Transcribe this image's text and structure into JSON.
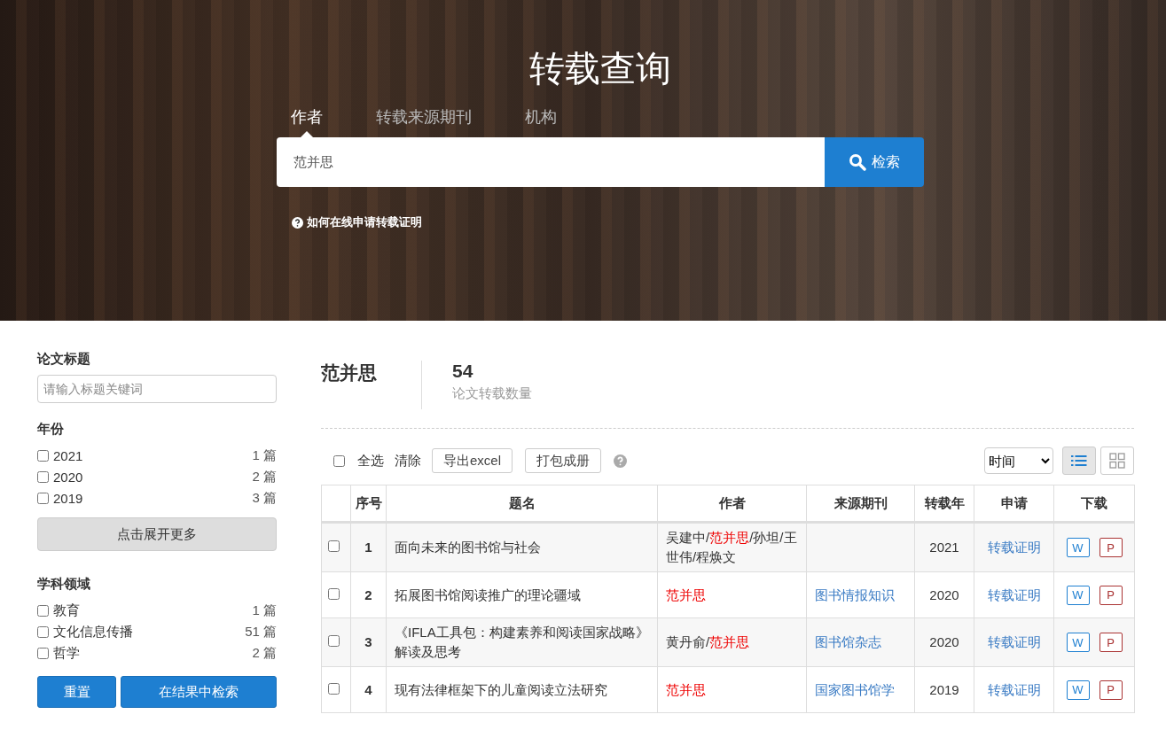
{
  "hero": {
    "title": "转载查询",
    "tabs": [
      {
        "label": "作者",
        "selected": true
      },
      {
        "label": "转载来源期刊",
        "selected": false
      },
      {
        "label": "机构",
        "selected": false
      }
    ],
    "search": {
      "value": "范并思",
      "button": "检索"
    },
    "help_link": "如何在线申请转载证明"
  },
  "sidebar": {
    "title_filter": {
      "heading": "论文标题",
      "placeholder": "请输入标题关键词"
    },
    "year_filter": {
      "heading": "年份",
      "items": [
        {
          "label": "2021",
          "count": "1 篇",
          "checked": false
        },
        {
          "label": "2020",
          "count": "2 篇",
          "checked": false
        },
        {
          "label": "2019",
          "count": "3 篇",
          "checked": false
        }
      ],
      "more_button": "点击展开更多"
    },
    "subject_filter": {
      "heading": "学科领域",
      "items": [
        {
          "label": "教育",
          "count": "1 篇",
          "checked": false
        },
        {
          "label": "文化信息传播",
          "count": "51 篇",
          "checked": false
        },
        {
          "label": "哲学",
          "count": "2 篇",
          "checked": false
        }
      ]
    },
    "buttons": [
      "重置",
      "在结果中检索"
    ]
  },
  "summary": {
    "author": "范并思",
    "count": "54",
    "count_label": "论文转载数量"
  },
  "toolbar": {
    "select_all": {
      "label": "全选",
      "checked": false
    },
    "clear": "清除",
    "export": "导出excel",
    "pack": "打包成册",
    "sort": "时间",
    "views": [
      {
        "kind": "list",
        "selected": true
      },
      {
        "kind": "grid",
        "selected": false
      }
    ]
  },
  "table": {
    "columns": [
      "序号",
      "题名",
      "作者",
      "来源期刊",
      "转载年",
      "申请",
      "下载"
    ],
    "rows": [
      {
        "checked": false,
        "index": "1",
        "title": "面向未来的图书馆与社会",
        "authors": [
          {
            "text": "吴建中/",
            "highlight": false
          },
          {
            "text": "范并思",
            "highlight": true
          },
          {
            "text": "/孙坦/王世伟/程焕文",
            "highlight": false
          }
        ],
        "journal": "",
        "year": "2021",
        "apply": "转载证明",
        "downloads": [
          "W",
          "P"
        ]
      },
      {
        "checked": false,
        "index": "2",
        "title": "拓展图书馆阅读推广的理论疆域",
        "authors": [
          {
            "text": "范并思",
            "highlight": true
          }
        ],
        "journal": "图书情报知识",
        "year": "2020",
        "apply": "转载证明",
        "downloads": [
          "W",
          "P"
        ]
      },
      {
        "checked": false,
        "index": "3",
        "title": "《IFLA工具包：构建素养和阅读国家战略》解读及思考",
        "authors": [
          {
            "text": "黄丹俞/",
            "highlight": false
          },
          {
            "text": "范并思",
            "highlight": true
          }
        ],
        "journal": "图书馆杂志",
        "year": "2020",
        "apply": "转载证明",
        "downloads": [
          "W",
          "P"
        ]
      },
      {
        "checked": false,
        "index": "4",
        "title": "现有法律框架下的儿童阅读立法研究",
        "authors": [
          {
            "text": "范并思",
            "highlight": true
          }
        ],
        "journal": "国家图书馆学",
        "year": "2019",
        "apply": "转载证明",
        "downloads": [
          "W",
          "P"
        ]
      }
    ]
  }
}
